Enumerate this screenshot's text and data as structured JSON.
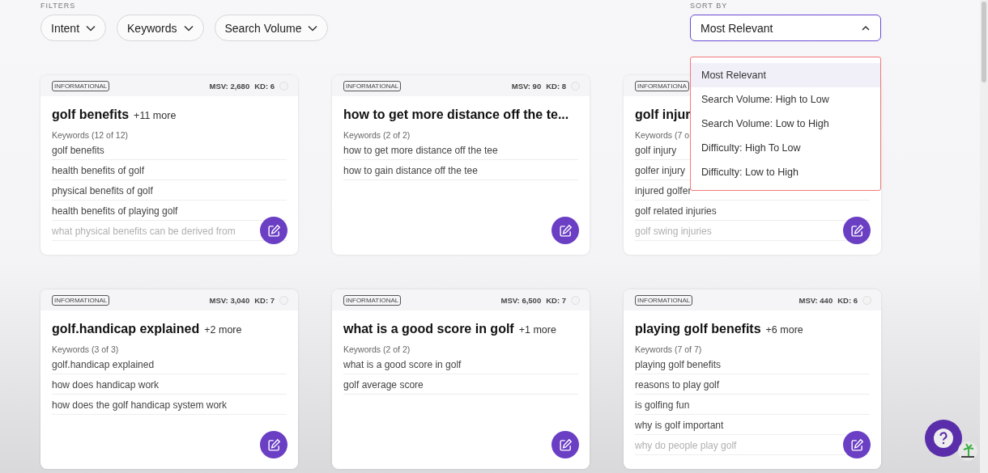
{
  "filters": {
    "label": "FILTERS",
    "items": [
      {
        "label": "Intent"
      },
      {
        "label": "Keywords"
      },
      {
        "label": "Search Volume"
      }
    ]
  },
  "sort": {
    "label": "SORT BY",
    "value": "Most Relevant",
    "expanded": true,
    "options": [
      {
        "label": "Most Relevant",
        "selected": true
      },
      {
        "label": "Search Volume: High to Low",
        "selected": false
      },
      {
        "label": "Search Volume: Low to High",
        "selected": false
      },
      {
        "label": "Difficulty: High To Low",
        "selected": false
      },
      {
        "label": "Difficulty: Low to High",
        "selected": false
      }
    ]
  },
  "cards": [
    {
      "badge": "INFORMATIONAL",
      "msv": "MSV: 2,680",
      "kd": "KD: 6",
      "title": "golf benefits",
      "more": "+11 more",
      "keywords_label": "Keywords (12 of 12)",
      "keywords": [
        "golf benefits",
        "health benefits of golf",
        "physical benefits of golf",
        "health benefits of playing golf",
        "what physical benefits can be derived from"
      ]
    },
    {
      "badge": "INFORMATIONAL",
      "msv": "MSV: 90",
      "kd": "KD: 8",
      "title": "how to get more distance off the te...",
      "keywords_label": "Keywords (2 of 2)",
      "keywords": [
        "how to get more distance off the tee",
        "how to gain distance off the tee"
      ]
    },
    {
      "badge": "INFORMATIONA",
      "title": "golf injur",
      "keywords_label": "Keywords (7 o",
      "keywords": [
        "golf injury",
        "golfer injury",
        "injured golfer",
        "golf related injuries",
        "golf swing injuries"
      ]
    },
    {
      "badge": "INFORMATIONAL",
      "msv": "MSV: 3,040",
      "kd": "KD: 7",
      "title": "golf.handicap explained",
      "more": "+2 more",
      "keywords_label": "Keywords (3 of 3)",
      "keywords": [
        "golf.handicap explained",
        "how does handicap work",
        "how does the golf handicap system work"
      ]
    },
    {
      "badge": "INFORMATIONAL",
      "msv": "MSV: 6,500",
      "kd": "KD: 7",
      "title": "what is a good score in golf",
      "more": "+1 more",
      "keywords_label": "Keywords (2 of 2)",
      "keywords": [
        "what is a good score in golf",
        "golf average score"
      ]
    },
    {
      "badge": "INFORMATIONAL",
      "msv": "MSV: 440",
      "kd": "KD: 6",
      "title": "playing golf benefits",
      "more": "+6 more",
      "keywords_label": "Keywords (7 of 7)",
      "keywords": [
        "playing golf benefits",
        "reasons to play golf",
        "is golfing fun",
        "why is golf important",
        "why do people play golf"
      ]
    }
  ]
}
